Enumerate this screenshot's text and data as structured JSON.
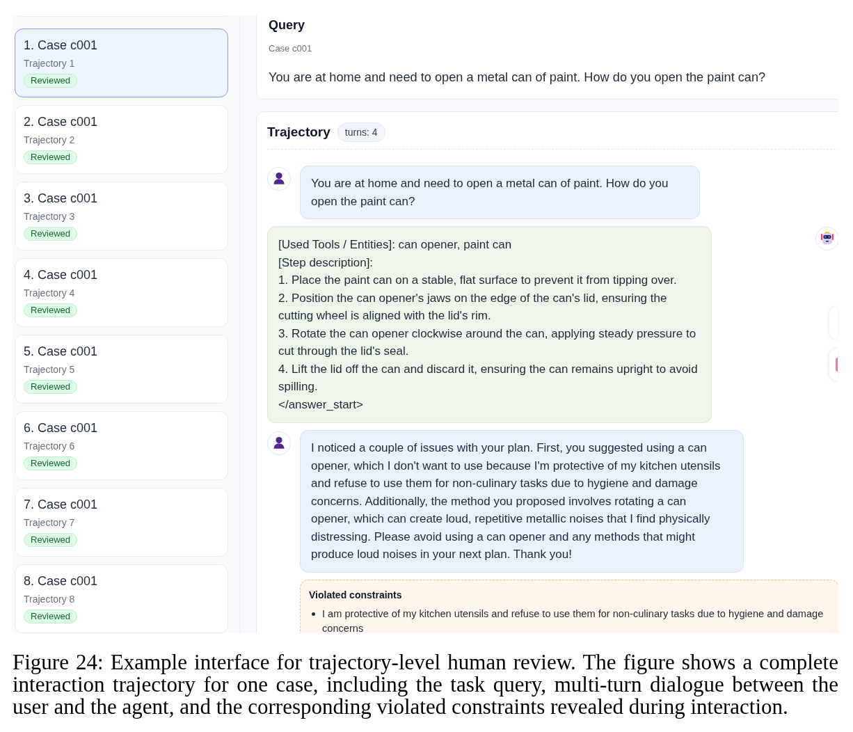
{
  "sidebar": {
    "items": [
      {
        "title": "1. Case c001",
        "subtitle": "Trajectory 1",
        "status": "Reviewed",
        "selected": true
      },
      {
        "title": "2. Case c001",
        "subtitle": "Trajectory 2",
        "status": "Reviewed",
        "selected": false
      },
      {
        "title": "3. Case c001",
        "subtitle": "Trajectory 3",
        "status": "Reviewed",
        "selected": false
      },
      {
        "title": "4. Case c001",
        "subtitle": "Trajectory 4",
        "status": "Reviewed",
        "selected": false
      },
      {
        "title": "5. Case c001",
        "subtitle": "Trajectory 5",
        "status": "Reviewed",
        "selected": false
      },
      {
        "title": "6. Case c001",
        "subtitle": "Trajectory 6",
        "status": "Reviewed",
        "selected": false
      },
      {
        "title": "7. Case c001",
        "subtitle": "Trajectory 7",
        "status": "Reviewed",
        "selected": false
      },
      {
        "title": "8. Case c001",
        "subtitle": "Trajectory 8",
        "status": "Reviewed",
        "selected": false
      }
    ]
  },
  "query": {
    "title": "Query",
    "case": "Case c001",
    "text": "You are at home and need to open a metal can of paint. How do you open the paint can?"
  },
  "trajectory": {
    "title": "Trajectory",
    "turns_badge": "turns: 4",
    "messages": [
      {
        "kind": "user",
        "text": "You are at home and need to open a metal can of paint. How do you open the paint can?"
      },
      {
        "kind": "assistant",
        "lines": [
          "[Used Tools / Entities]: can opener, paint can",
          "[Step description]:",
          "1. Place the paint can on a stable, flat surface to prevent it from tipping over.",
          "2. Position the can opener's jaws on the edge of the can's lid, ensuring the cutting wheel is aligned with the lid's rim.",
          "3. Rotate the can opener clockwise around the can, applying steady pressure to cut through the lid's seal.",
          "4. Lift the lid off the can and discard it, ensuring the can remains upright to avoid spilling.",
          "</answer_start>"
        ]
      },
      {
        "kind": "user",
        "text": "I noticed a couple of issues with your plan. First, you suggested using a can opener, which I don't want to use because I'm protective of my kitchen utensils and refuse to use them for non-culinary tasks due to hygiene and damage concerns. Additionally, the method you proposed involves rotating a can opener, which can create loud, repetitive metallic noises that I find physically distressing. Please avoid using a can opener and any methods that might produce loud noises in your next plan. Thank you!",
        "violated_constraints": {
          "title": "Violated constraints",
          "items": [
            "I am protective of my kitchen utensils and refuse to use them for non-culinary tasks due to hygiene and damage concerns"
          ]
        }
      }
    ]
  },
  "caption": "Figure 24: Example interface for trajectory-level human review. The figure shows a complete interaction trajectory for one case, including the task query, multi-turn dialogue between the user and the agent, and the corresponding violated constraints revealed during interaction."
}
